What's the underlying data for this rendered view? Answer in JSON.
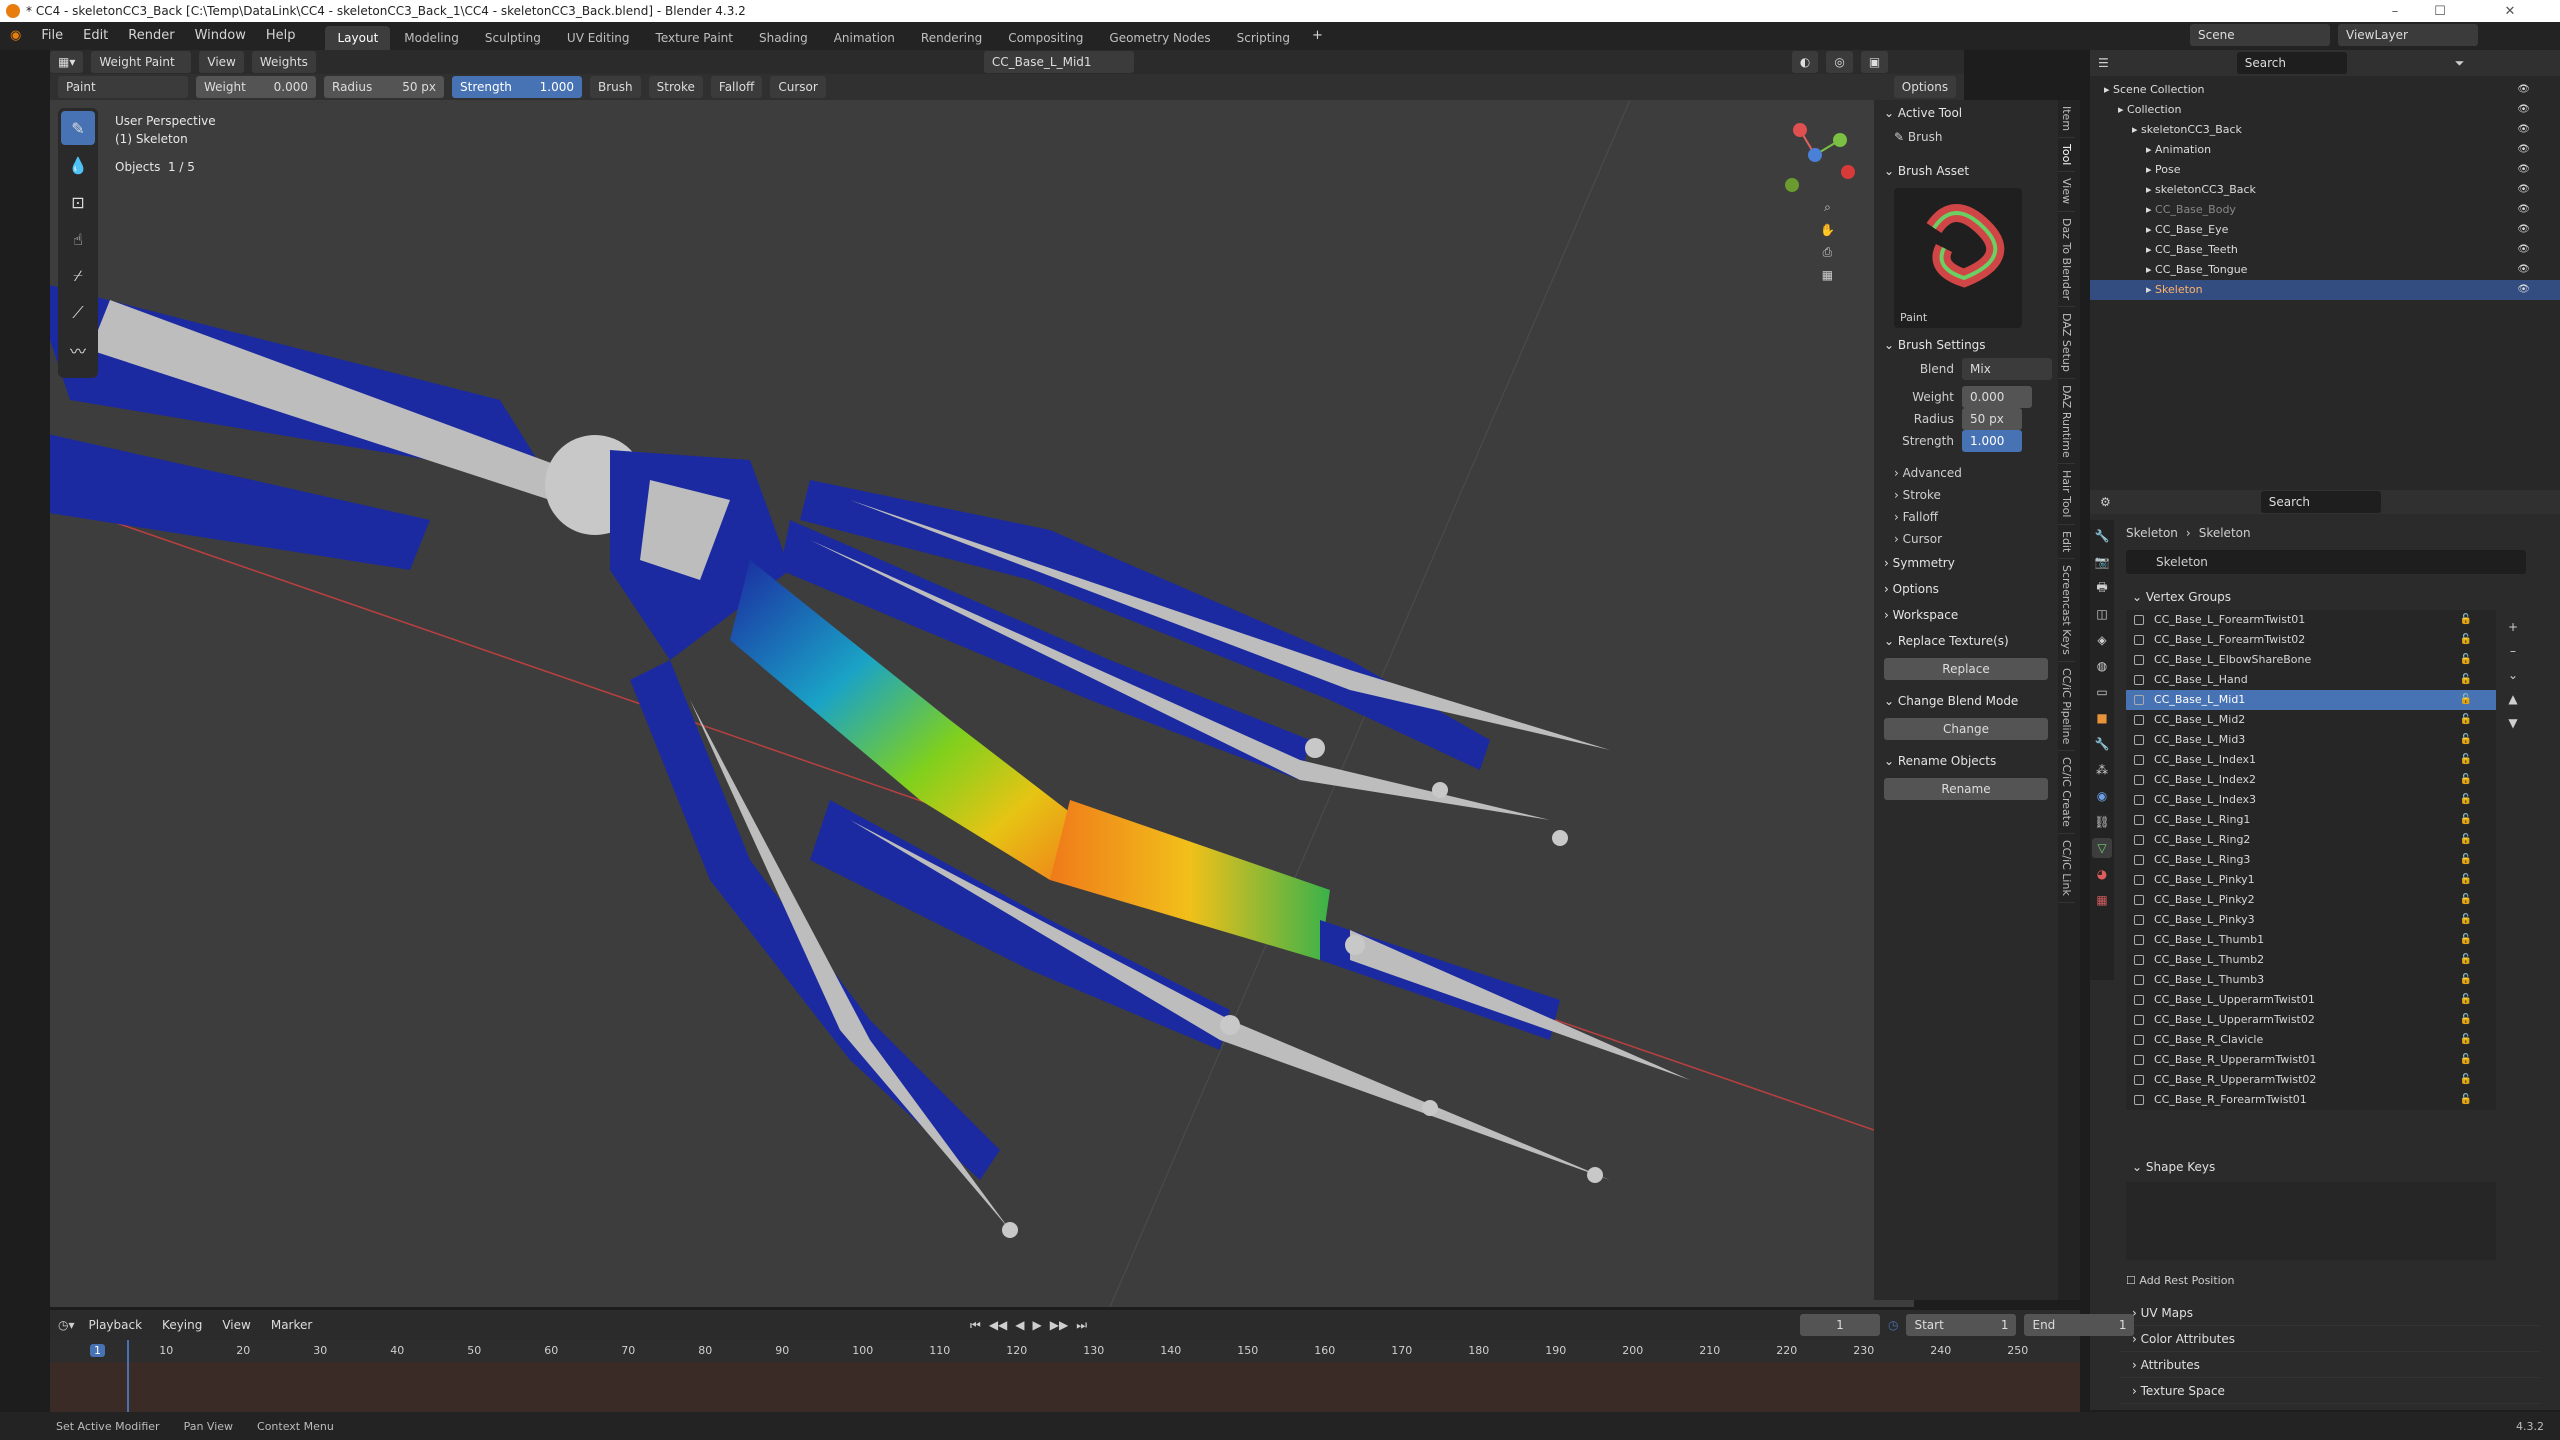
{
  "window": {
    "title": "* CC4 - skeletonCC3_Back [C:\\Temp\\DataLink\\CC4 - skeletonCC3_Back_1\\CC4 - skeletonCC3_Back.blend] - Blender 4.3.2"
  },
  "menubar": {
    "menus": [
      "File",
      "Edit",
      "Render",
      "Window",
      "Help"
    ],
    "workspaces": [
      "Layout",
      "Modeling",
      "Sculpting",
      "UV Editing",
      "Texture Paint",
      "Shading",
      "Animation",
      "Rendering",
      "Compositing",
      "Geometry Nodes",
      "Scripting"
    ],
    "active_workspace": "Layout",
    "scene": "Scene",
    "view_layer": "ViewLayer"
  },
  "viewport_header": {
    "mode": "Weight Paint",
    "view": "View",
    "weights": "Weights",
    "active_group": "CC_Base_L_Mid1",
    "options": "Options"
  },
  "tool_header": {
    "tool": "Paint",
    "weight_label": "Weight",
    "weight_value": "0.000",
    "radius_label": "Radius",
    "radius_value": "50 px",
    "strength_label": "Strength",
    "strength_value": "1.000",
    "brush": "Brush",
    "stroke": "Stroke",
    "falloff": "Falloff",
    "cursor": "Cursor"
  },
  "viewport": {
    "perspective": "User Perspective",
    "object": "(1) Skeleton",
    "objects_label": "Objects",
    "objects_count": "1 / 5"
  },
  "sidebar": {
    "active_tool_title": "Active Tool",
    "brush_label": "Brush",
    "brush_asset_title": "Brush Asset",
    "brush_asset_name": "Paint",
    "brush_settings_title": "Brush Settings",
    "blend_label": "Blend",
    "blend_value": "Mix",
    "weight_label": "Weight",
    "weight_value": "0.000",
    "radius_label": "Radius",
    "radius_value": "50 px",
    "strength_label": "Strength",
    "strength_value": "1.000",
    "sub_sections": [
      "Advanced",
      "Stroke",
      "Falloff",
      "Cursor"
    ],
    "sections": [
      "Symmetry",
      "Options",
      "Workspace"
    ],
    "replace_title": "Replace Texture(s)",
    "replace_btn": "Replace",
    "blend_mode_title": "Change Blend Mode",
    "change_btn": "Change",
    "rename_title": "Rename Objects",
    "rename_btn": "Rename"
  },
  "side_tabs": [
    "Item",
    "Tool",
    "View",
    "Daz To Blender",
    "DAZ Setup",
    "DAZ Runtime",
    "Hair Tool",
    "Edit",
    "Screencast Keys",
    "CC/iC Pipeline",
    "CC/iC Create",
    "CC/iC Link"
  ],
  "outliner": {
    "search_placeholder": "Search",
    "items": [
      {
        "label": "Scene Collection",
        "indent": 0,
        "color": "#dddddd"
      },
      {
        "label": "Collection",
        "indent": 1,
        "color": "#dddddd"
      },
      {
        "label": "skeletonCC3_Back",
        "indent": 2,
        "color": "#dddddd"
      },
      {
        "label": "Animation",
        "indent": 3,
        "color": "#dddddd"
      },
      {
        "label": "Pose",
        "indent": 3,
        "color": "#dddddd"
      },
      {
        "label": "skeletonCC3_Back",
        "indent": 3,
        "color": "#dddddd"
      },
      {
        "label": "CC_Base_Body",
        "indent": 3,
        "color": "#888888"
      },
      {
        "label": "CC_Base_Eye",
        "indent": 3,
        "color": "#dddddd"
      },
      {
        "label": "CC_Base_Teeth",
        "indent": 3,
        "color": "#dddddd"
      },
      {
        "label": "CC_Base_Tongue",
        "indent": 3,
        "color": "#dddddd"
      },
      {
        "label": "Skeleton",
        "indent": 3,
        "color": "#ffb36b"
      }
    ],
    "selected_index": 10
  },
  "properties": {
    "search_placeholder": "Search",
    "breadcrumb_1": "Skeleton",
    "breadcrumb_2": "Skeleton",
    "mesh_name": "Skeleton",
    "vertex_groups_title": "Vertex Groups",
    "vertex_groups": [
      "CC_Base_L_ForearmTwist01",
      "CC_Base_L_ForearmTwist02",
      "CC_Base_L_ElbowShareBone",
      "CC_Base_L_Hand",
      "CC_Base_L_Mid1",
      "CC_Base_L_Mid2",
      "CC_Base_L_Mid3",
      "CC_Base_L_Index1",
      "CC_Base_L_Index2",
      "CC_Base_L_Index3",
      "CC_Base_L_Ring1",
      "CC_Base_L_Ring2",
      "CC_Base_L_Ring3",
      "CC_Base_L_Pinky1",
      "CC_Base_L_Pinky2",
      "CC_Base_L_Pinky3",
      "CC_Base_L_Thumb1",
      "CC_Base_L_Thumb2",
      "CC_Base_L_Thumb3",
      "CC_Base_L_UpperarmTwist01",
      "CC_Base_L_UpperarmTwist02",
      "CC_Base_R_Clavicle",
      "CC_Base_R_UpperarmTwist01",
      "CC_Base_R_UpperarmTwist02",
      "CC_Base_R_ForearmTwist01"
    ],
    "selected_group_index": 4,
    "shape_keys_title": "Shape Keys",
    "add_rest_position": "Add Rest Position",
    "more_sections": [
      "UV Maps",
      "Color Attributes",
      "Attributes",
      "Texture Space"
    ]
  },
  "timeline": {
    "menus": [
      "Playback",
      "Keying",
      "View",
      "Marker"
    ],
    "current_frame": "1",
    "start_label": "Start",
    "start_value": "1",
    "end_label": "End",
    "end_value": "1",
    "ruler": [
      "1",
      "10",
      "20",
      "30",
      "40",
      "50",
      "60",
      "70",
      "80",
      "90",
      "100",
      "110",
      "120",
      "130",
      "140",
      "150",
      "160",
      "170",
      "180",
      "190",
      "200",
      "210",
      "220",
      "230",
      "240",
      "250"
    ]
  },
  "statusbar": {
    "items": [
      "Set Active Modifier",
      "Pan View",
      "Context Menu"
    ],
    "version": "4.3.2"
  },
  "colors": {
    "accent": "#4772b3",
    "bone_blue": "#1b2aa0",
    "bone_grey": "#bdbdbd"
  }
}
